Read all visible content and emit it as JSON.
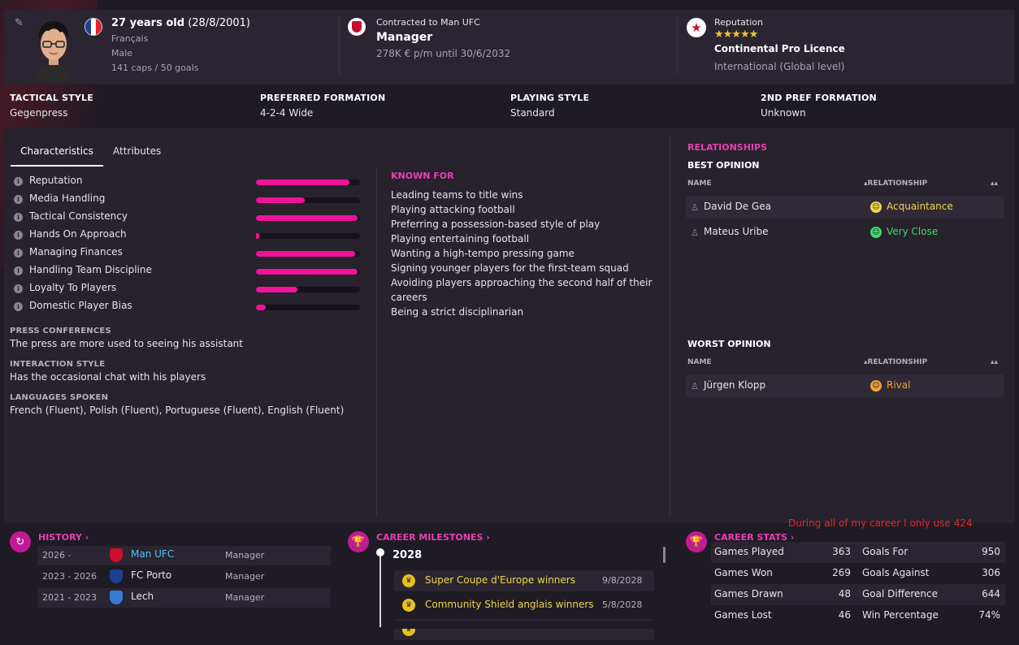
{
  "profile": {
    "age_bold": "27 years old",
    "birthdate": " (28/8/2001)",
    "nationality": "Français",
    "gender": "Male",
    "caps": "141 caps / 50 goals",
    "flag_colors": [
      "#1d3f94",
      "#ffffff",
      "#e1222f"
    ]
  },
  "contract": {
    "label": "Contracted to Man UFC",
    "role": "Manager",
    "wage": "278K € p/m until 30/6/2032"
  },
  "reputation": {
    "label": "Reputation",
    "stars": "★★★★★",
    "licence": "Continental Pro Licence",
    "level": "International (Global level)"
  },
  "tactics": [
    {
      "header": "TACTICAL STYLE",
      "value": "Gegenpress"
    },
    {
      "header": "PREFERRED FORMATION",
      "value": "4-2-4 Wide"
    },
    {
      "header": "PLAYING STYLE",
      "value": "Standard"
    },
    {
      "header": "2ND PREF FORMATION",
      "value": "Unknown"
    }
  ],
  "tabs": [
    "Characteristics",
    "Attributes"
  ],
  "characteristics": [
    {
      "label": "Reputation",
      "level": 0.9
    },
    {
      "label": "Media Handling",
      "level": 0.47
    },
    {
      "label": "Tactical Consistency",
      "level": 0.98
    },
    {
      "label": "Hands On Approach",
      "level": 0.03
    },
    {
      "label": "Managing Finances",
      "level": 0.95
    },
    {
      "label": "Handling Team Discipline",
      "level": 0.98
    },
    {
      "label": "Loyalty To Players",
      "level": 0.4
    },
    {
      "label": "Domestic Player Bias",
      "level": 0.09
    }
  ],
  "press": {
    "header": "PRESS CONFERENCES",
    "value": "The press are more used to seeing his assistant"
  },
  "interaction": {
    "header": "INTERACTION STYLE",
    "value": "Has the occasional chat with his players"
  },
  "languages": {
    "header": "LANGUAGES SPOKEN",
    "value": "French (Fluent), Polish (Fluent), Portuguese (Fluent), English (Fluent)"
  },
  "known_for": {
    "header": "KNOWN FOR",
    "items": [
      "Leading teams to title wins",
      "Playing attacking football",
      "Preferring a possession-based style of play",
      "Playing entertaining football",
      "Wanting a high-tempo pressing game",
      "Signing younger players for the first-team squad",
      "Avoiding players approaching the second half of their careers",
      "Being a strict disciplinarian"
    ]
  },
  "relationships": {
    "header": "RELATIONSHIPS",
    "best": {
      "title": "BEST OPINION",
      "col_name": "NAME",
      "col_rel": "▴RELATIONSHIP",
      "rows": [
        {
          "name": "David De Gea",
          "relation": "Acquaintance",
          "color": "#f0d64a"
        },
        {
          "name": "Mateus Uribe",
          "relation": "Very Close",
          "color": "#3ddc6a"
        }
      ]
    },
    "worst": {
      "title": "WORST OPINION",
      "col_name": "NAME",
      "col_rel": "▴RELATIONSHIP",
      "rows": [
        {
          "name": "Jürgen Klopp",
          "relation": "Rival",
          "color": "#f0a23a"
        }
      ]
    }
  },
  "history": {
    "header": "HISTORY ›",
    "rows": [
      {
        "years": "2026 -",
        "club": "Man UFC",
        "role": "Manager",
        "club_color": "#4fc3f7",
        "badge": "#c8102e"
      },
      {
        "years": "2023 - 2026",
        "club": "FC Porto",
        "role": "Manager",
        "club_color": "#e6e4ea",
        "badge": "#1d3f94"
      },
      {
        "years": "2021 - 2023",
        "club": "Lech",
        "role": "Manager",
        "club_color": "#e6e4ea",
        "badge": "#3a7bd5"
      }
    ]
  },
  "milestones": {
    "header": "CAREER MILESTONES ›",
    "year": "2028",
    "rows": [
      {
        "title": "Super Coupe d'Europe winners",
        "date": "9/8/2028"
      },
      {
        "title": "Community Shield anglais winners",
        "date": "5/8/2028"
      }
    ]
  },
  "career_stats": {
    "header": "CAREER STATS ›",
    "rows": [
      {
        "l1": "Games Played",
        "v1": "363",
        "l2": "Goals For",
        "v2": "950"
      },
      {
        "l1": "Games Won",
        "v1": "269",
        "l2": "Goals Against",
        "v2": "306"
      },
      {
        "l1": "Games Drawn",
        "v1": "48",
        "l2": "Goal Difference",
        "v2": "644"
      },
      {
        "l1": "Games Lost",
        "v1": "46",
        "l2": "Win Percentage",
        "v2": "74%"
      }
    ]
  },
  "annotation": "During all of my career I only use 424",
  "colors": {
    "accent": "#e83fb5",
    "bar": "#f0129a"
  }
}
